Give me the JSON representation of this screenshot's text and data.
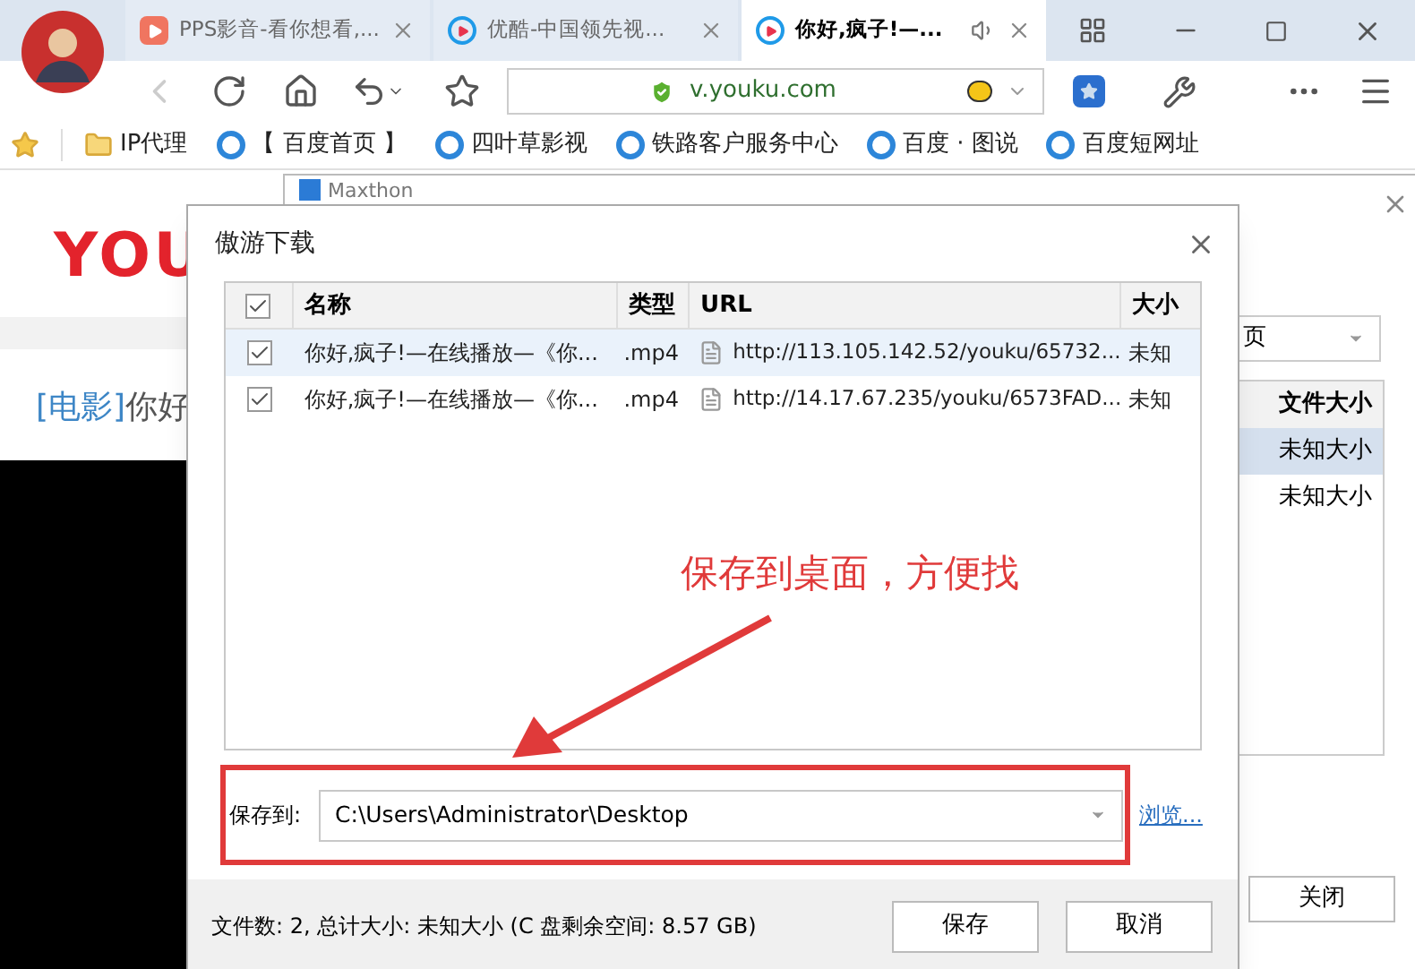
{
  "browser": {
    "tabs": [
      {
        "title": "PPS影音-看你想看,...",
        "selected": false,
        "audio": false
      },
      {
        "title": "优酷-中国领先视...",
        "selected": false,
        "audio": false
      },
      {
        "title": "你好,疯子!—...",
        "selected": true,
        "audio": true
      }
    ],
    "address": "v.youku.com",
    "bookmarks": [
      {
        "label": "IP代理",
        "kind": "folder"
      },
      {
        "label": "【 百度首页 】",
        "kind": "ie"
      },
      {
        "label": "四叶草影视",
        "kind": "ie"
      },
      {
        "label": "铁路客户服务中心",
        "kind": "ie"
      },
      {
        "label": "百度 · 图说",
        "kind": "ie"
      },
      {
        "label": "百度短网址",
        "kind": "ie"
      }
    ]
  },
  "page": {
    "logo": "YOU",
    "category": "[电影]",
    "title": "你好"
  },
  "back_window": {
    "title": "Maxthon",
    "dropdown": "页",
    "column": "文件大小",
    "rows": [
      {
        "size": "未知大小",
        "selected": true
      },
      {
        "size": "未知大小",
        "selected": false
      }
    ],
    "close_button": "关闭"
  },
  "dialog": {
    "title": "傲游下载",
    "all_checked": true,
    "columns": [
      "名称",
      "类型",
      "URL",
      "大小"
    ],
    "rows": [
      {
        "checked": true,
        "selected": true,
        "name": "你好,疯子!—在线播放—《你...",
        "type": ".mp4",
        "url": "http://113.105.142.52/youku/65732...",
        "size": "未知"
      },
      {
        "checked": true,
        "selected": false,
        "name": "你好,疯子!—在线播放—《你...",
        "type": ".mp4",
        "url": "http://14.17.67.235/youku/6573FAD...",
        "size": "未知"
      }
    ],
    "save_label": "保存到:",
    "save_path": "C:\\Users\\Administrator\\Desktop",
    "browse": "浏览...",
    "status": "文件数: 2, 总计大小: 未知大小 (C 盘剩余空间: 8.57 GB)",
    "buttons": [
      "保存",
      "取消"
    ]
  },
  "annotation": "保存到桌面，方便找"
}
